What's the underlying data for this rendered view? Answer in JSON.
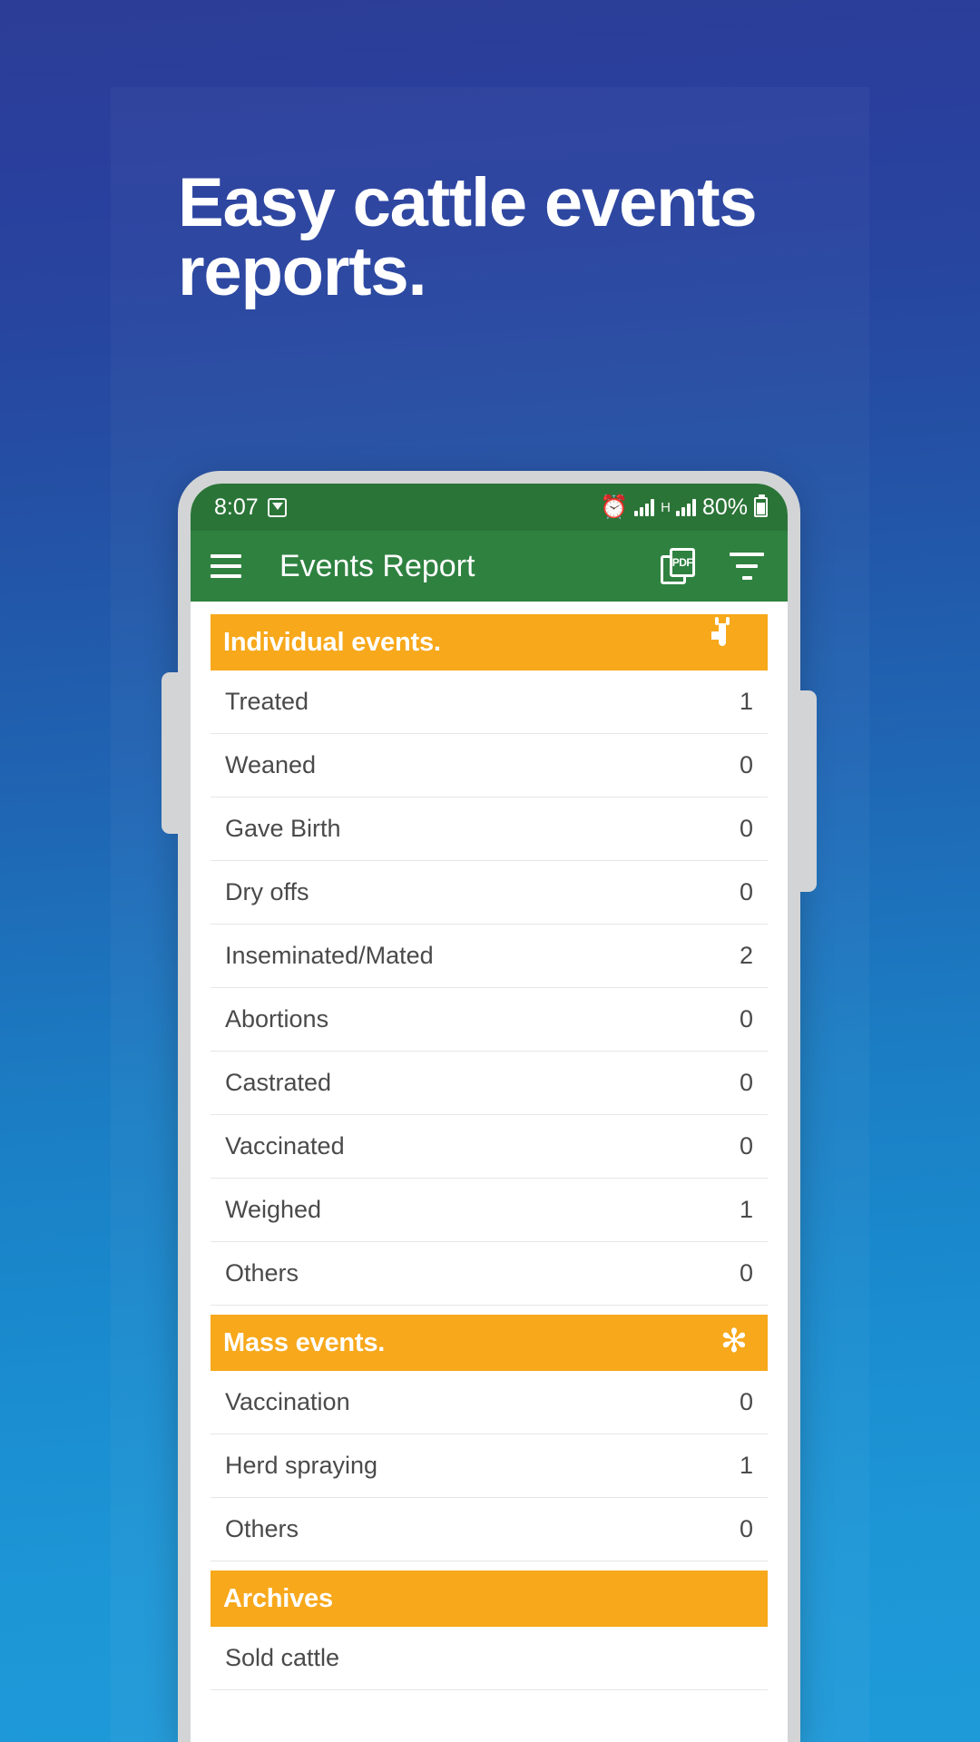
{
  "promo": {
    "headline_line1": "Easy cattle events",
    "headline_line2": "reports.",
    "background_top_color": "#2b3d96",
    "background_bottom_color": "#1f9ad9"
  },
  "phone": {
    "status_bar": {
      "time": "8:07",
      "left_icon": "download-badge-icon",
      "alarm_icon": "alarm-icon",
      "signal_icon_1": "signal-bars-icon",
      "network_type": "H",
      "signal_icon_2": "signal-bars-icon",
      "battery_percent": "80%",
      "battery_icon": "battery-charging-icon",
      "background_color": "#2b7437"
    },
    "app_bar": {
      "menu_label": "menu",
      "title": "Events Report",
      "pdf_label": "PDF",
      "pdf_action": "Export PDF",
      "filter_action": "Filter",
      "background_color": "#2f8140"
    },
    "accent_color": "#f7a81b",
    "sections": [
      {
        "title": "Individual events.",
        "icon": "calendar-icon",
        "rows": [
          {
            "label": "Treated",
            "value": "1"
          },
          {
            "label": "Weaned",
            "value": "0"
          },
          {
            "label": "Gave Birth",
            "value": "0"
          },
          {
            "label": "Dry offs",
            "value": "0"
          },
          {
            "label": "Inseminated/Mated",
            "value": "2"
          },
          {
            "label": "Abortions",
            "value": "0"
          },
          {
            "label": "Castrated",
            "value": "0"
          },
          {
            "label": "Vaccinated",
            "value": "0"
          },
          {
            "label": "Weighed",
            "value": "1"
          },
          {
            "label": "Others",
            "value": "0"
          }
        ]
      },
      {
        "title": "Mass events.",
        "icon": "snowflake-icon",
        "rows": [
          {
            "label": "Vaccination",
            "value": "0"
          },
          {
            "label": "Herd spraying",
            "value": "1"
          },
          {
            "label": "Others",
            "value": "0"
          }
        ]
      },
      {
        "title": "Archives",
        "icon": "archive-box-icon",
        "rows": [
          {
            "label": "Sold cattle",
            "value": ""
          }
        ]
      }
    ]
  }
}
